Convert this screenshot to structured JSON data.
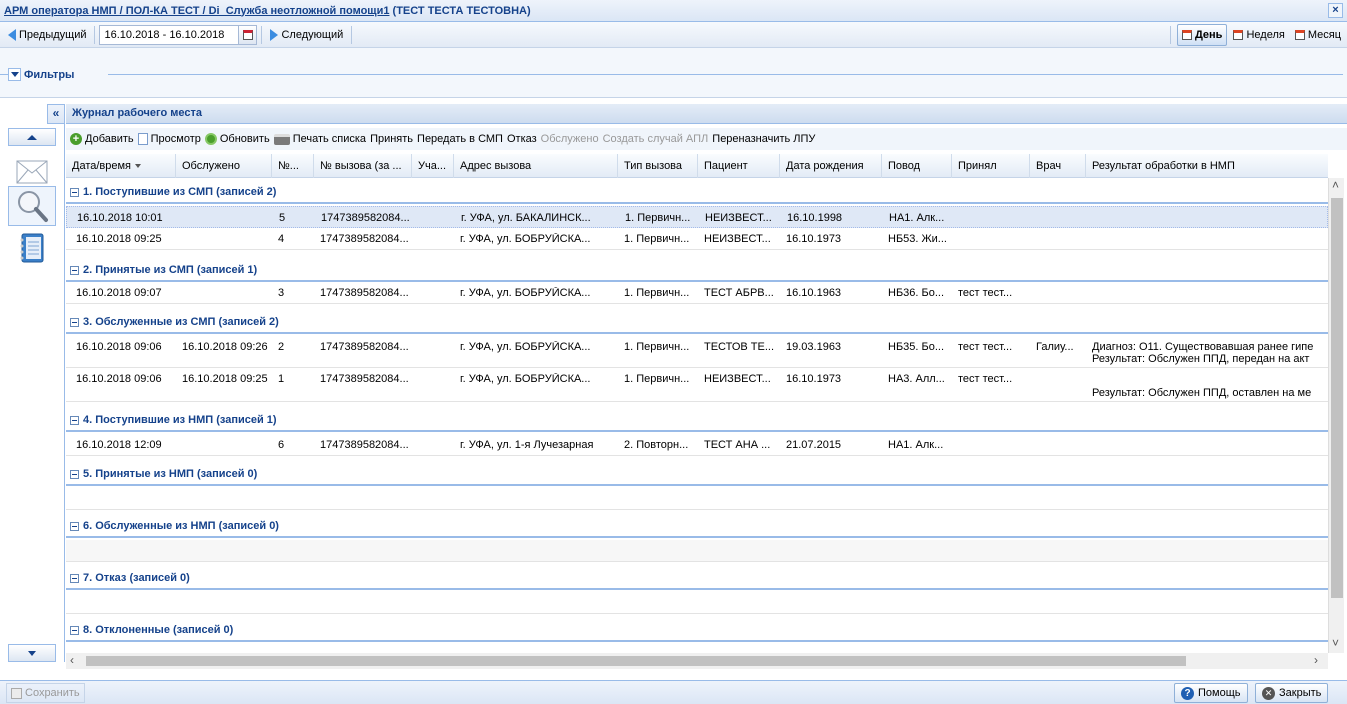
{
  "window": {
    "title_link": "АРМ оператора НМП / ПОЛ-КА ТЕСТ / Di_Служба неотложной помощи1",
    "title_user": " (ТЕСТ ТЕСТА ТЕСТОВНА)",
    "close_glyph": "×"
  },
  "nav": {
    "prev_label": "Предыдущий",
    "date_range": "16.10.2018 - 16.10.2018",
    "next_label": "Следующий",
    "day_label": "День",
    "week_label": "Неделя",
    "month_label": "Месяц"
  },
  "filters": {
    "label": "Фильтры"
  },
  "panel": {
    "title": "Журнал рабочего места",
    "collapse_glyph": "«"
  },
  "toolbar": {
    "add": "Добавить",
    "view": "Просмотр",
    "refresh": "Обновить",
    "print": "Печать списка",
    "accept": "Принять",
    "transfer": "Передать в СМП",
    "refuse": "Отказ",
    "served": "Обслужено",
    "create_case": "Создать случай АПЛ",
    "reassign": "Переназначить ЛПУ"
  },
  "columns": [
    "Дата/время",
    "Обслужено",
    "№...",
    "№ вызова (за ...",
    "Уча...",
    "Адрес вызова",
    "Тип вызова",
    "Пациент",
    "Дата рождения",
    "Повод",
    "Принял",
    "Врач",
    "Результат обработки в НМП"
  ],
  "groups": [
    {
      "title": "1. Поступившие из СМП (записей 2)",
      "rows": [
        {
          "dt": "16.10.2018 10:01",
          "served": "",
          "num": "5",
          "call": "1747389582084...",
          "addr": "г. УФА, ул. БАКАЛИНСК...",
          "type": "1. Первичн...",
          "patient": "НЕИЗВЕСТ...",
          "birth": "16.10.1998",
          "reason": "НА1. Алк...",
          "accepted": "",
          "doctor": "",
          "result1": "",
          "result2": ""
        },
        {
          "dt": "16.10.2018 09:25",
          "served": "",
          "num": "4",
          "call": "1747389582084...",
          "addr": "г. УФА, ул. БОБРУЙСКА...",
          "type": "1. Первичн...",
          "patient": "НЕИЗВЕСТ...",
          "birth": "16.10.1973",
          "reason": "НБ53. Жи...",
          "accepted": "",
          "doctor": "",
          "result1": "",
          "result2": ""
        }
      ]
    },
    {
      "title": "2. Принятые из СМП (записей 1)",
      "rows": [
        {
          "dt": "16.10.2018 09:07",
          "served": "",
          "num": "3",
          "call": "1747389582084...",
          "addr": "г. УФА, ул. БОБРУЙСКА...",
          "type": "1. Первичн...",
          "patient": "ТЕСТ АБРВ...",
          "birth": "16.10.1963",
          "reason": "НБ36. Бо...",
          "accepted": "тест тест...",
          "doctor": "",
          "result1": "",
          "result2": ""
        }
      ]
    },
    {
      "title": "3. Обслуженные из СМП (записей 2)",
      "rows": [
        {
          "dt": "16.10.2018 09:06",
          "served": "16.10.2018 09:26",
          "num": "2",
          "call": "1747389582084...",
          "addr": "г. УФА, ул. БОБРУЙСКА...",
          "type": "1. Первичн...",
          "patient": "ТЕСТОВ ТЕ...",
          "birth": "19.03.1963",
          "reason": "НБ35. Бо...",
          "accepted": "тест тест...",
          "doctor": "Галиу...",
          "result1": "Диагноз: O11. Существовавшая ранее гипе",
          "result2": "Результат: Обслужен ППД, передан на акт"
        },
        {
          "dt": "16.10.2018 09:06",
          "served": "16.10.2018 09:25",
          "num": "1",
          "call": "1747389582084...",
          "addr": "г. УФА, ул. БОБРУЙСКА...",
          "type": "1. Первичн...",
          "patient": "НЕИЗВЕСТ...",
          "birth": "16.10.1973",
          "reason": "НА3. Алл...",
          "accepted": "тест тест...",
          "doctor": "",
          "result1": "",
          "result2": "Результат: Обслужен ППД, оставлен на ме"
        }
      ]
    },
    {
      "title": "4. Поступившие из НМП (записей 1)",
      "rows": [
        {
          "dt": "16.10.2018 12:09",
          "served": "",
          "num": "6",
          "call": "1747389582084...",
          "addr": "г. УФА, ул. 1-я Лучезарная",
          "type": "2. Повторн...",
          "patient": "ТЕСТ АНА ...",
          "birth": "21.07.2015",
          "reason": "НА1. Алк...",
          "accepted": "",
          "doctor": "",
          "result1": "",
          "result2": ""
        }
      ]
    },
    {
      "title": "5. Принятые из НМП (записей 0)",
      "rows": []
    },
    {
      "title": "6. Обслуженные из НМП (записей 0)",
      "rows": []
    },
    {
      "title": "7. Отказ (записей 0)",
      "rows": []
    },
    {
      "title": "8. Отклоненные (записей 0)",
      "rows": []
    }
  ],
  "footer": {
    "save": "Сохранить",
    "help": "Помощь",
    "close": "Закрыть"
  }
}
